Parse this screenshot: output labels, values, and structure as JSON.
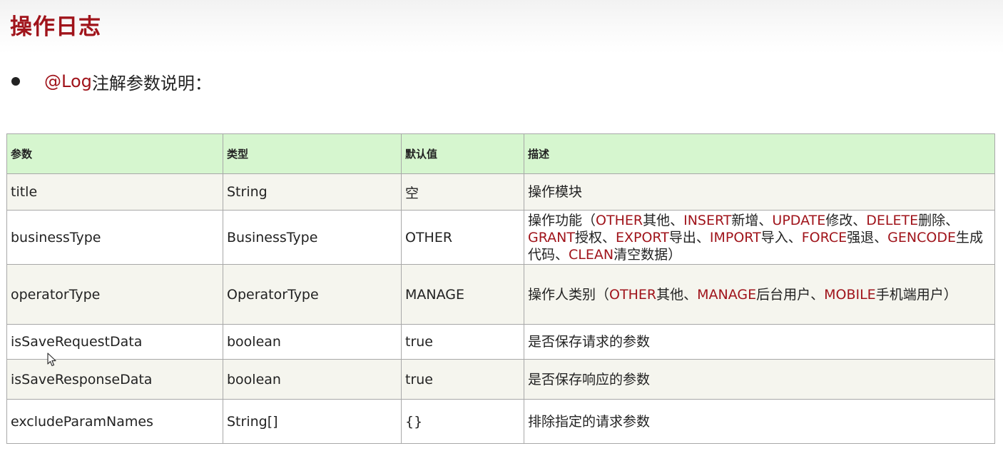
{
  "title": "操作日志",
  "bullet": {
    "accent": "@Log",
    "text": "注解参数说明："
  },
  "table": {
    "headers": [
      "参数",
      "类型",
      "默认值",
      "描述"
    ],
    "rows": [
      {
        "param": "title",
        "type": "String",
        "default": "空",
        "desc": [
          {
            "t": "操作模块",
            "red": false
          }
        ]
      },
      {
        "param": "businessType",
        "type": "BusinessType",
        "default": "OTHER",
        "desc": [
          {
            "t": "操作功能（",
            "red": false
          },
          {
            "t": "OTHER",
            "red": true
          },
          {
            "t": "其他、",
            "red": false
          },
          {
            "t": "INSERT",
            "red": true
          },
          {
            "t": "新增、",
            "red": false
          },
          {
            "t": "UPDATE",
            "red": true
          },
          {
            "t": "修改、",
            "red": false
          },
          {
            "t": "DELETE",
            "red": true
          },
          {
            "t": "删除、",
            "red": false
          },
          {
            "t": "GRANT",
            "red": true
          },
          {
            "t": "授权、",
            "red": false
          },
          {
            "t": "EXPORT",
            "red": true
          },
          {
            "t": "导出、",
            "red": false
          },
          {
            "t": "IMPORT",
            "red": true
          },
          {
            "t": "导入、",
            "red": false
          },
          {
            "t": "FORCE",
            "red": true
          },
          {
            "t": "强退、",
            "red": false
          },
          {
            "t": "GENCODE",
            "red": true
          },
          {
            "t": "生成代码、",
            "red": false
          },
          {
            "t": "CLEAN",
            "red": true
          },
          {
            "t": "清空数据）",
            "red": false
          }
        ]
      },
      {
        "param": "operatorType",
        "type": "OperatorType",
        "default": "MANAGE",
        "desc": [
          {
            "t": "操作人类别（",
            "red": false
          },
          {
            "t": "OTHER",
            "red": true
          },
          {
            "t": "其他、",
            "red": false
          },
          {
            "t": "MANAGE",
            "red": true
          },
          {
            "t": "后台用户、",
            "red": false
          },
          {
            "t": "MOBILE",
            "red": true
          },
          {
            "t": "手机端用户）",
            "red": false
          }
        ]
      },
      {
        "param": "isSaveRequestData",
        "type": "boolean",
        "default": "true",
        "desc": [
          {
            "t": "是否保存请求的参数",
            "red": false
          }
        ]
      },
      {
        "param": "isSaveResponseData",
        "type": "boolean",
        "default": "true",
        "desc": [
          {
            "t": "是否保存响应的参数",
            "red": false
          }
        ]
      },
      {
        "param": "excludeParamNames",
        "type": "String[]",
        "default": "{}",
        "desc": [
          {
            "t": "排除指定的请求参数",
            "red": false
          }
        ]
      }
    ]
  },
  "colors": {
    "accent": "#a0141b",
    "header_bg": "#d6f6cf",
    "odd_row_bg": "#f5f5ee"
  },
  "icons": {
    "cursor": "mouse-pointer-icon"
  }
}
